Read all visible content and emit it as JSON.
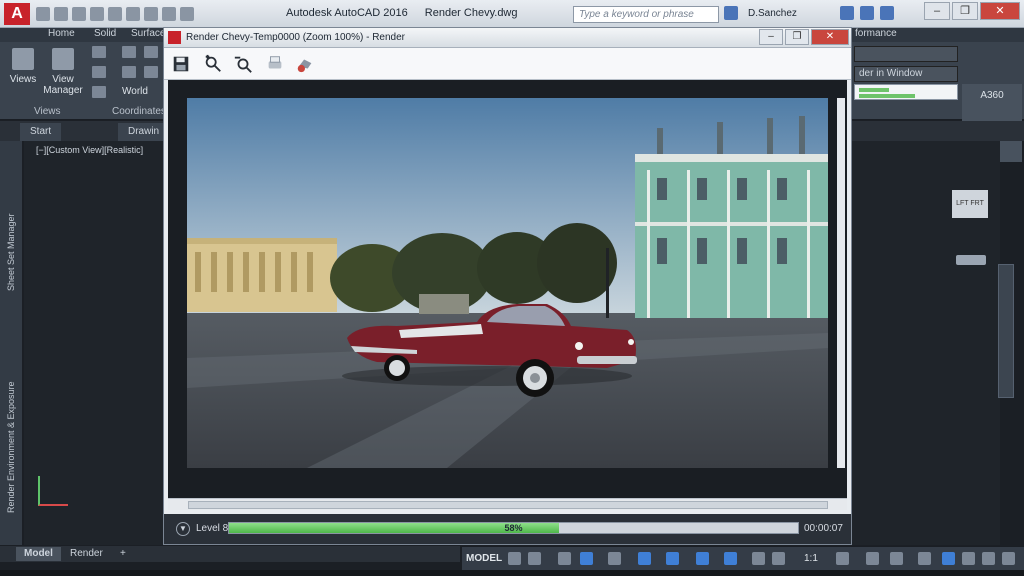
{
  "app": {
    "title": "Autodesk AutoCAD 2016",
    "document": "Render Chevy.dwg",
    "logo_letter": "A",
    "search_placeholder": "Type a keyword or phrase",
    "user": "D.Sanchez"
  },
  "ribbon": {
    "tabs": [
      "Home",
      "Solid",
      "Surface"
    ],
    "performance_tab": "formance",
    "views_label": "Views",
    "view_manager_label": "View Manager",
    "world_label": "World",
    "panel_views": "Views",
    "panel_coordinates": "Coordinates",
    "render_in_window": "der in Window",
    "a360": "A360"
  },
  "file_tabs": {
    "start": "Start",
    "drawing": "Drawin"
  },
  "viewport": {
    "label": "[−][Custom View][Realistic]"
  },
  "palettes": {
    "sheet_set_manager": "Sheet Set Manager",
    "render_environment": "Render Environment & Exposure"
  },
  "render_window": {
    "title": "Render Chevy-Temp0000 (Zoom 100%) - Render",
    "level": "Level 8",
    "progress_text": "58%",
    "progress_value": 0.58,
    "elapsed": "00:00:07"
  },
  "layout_tabs": {
    "model": "Model",
    "render": "Render",
    "add": "+"
  },
  "status_bar": {
    "model": "MODEL",
    "scale": "1:1"
  },
  "colors": {
    "accent": "#c8222a",
    "progress": "#4fb84a"
  }
}
